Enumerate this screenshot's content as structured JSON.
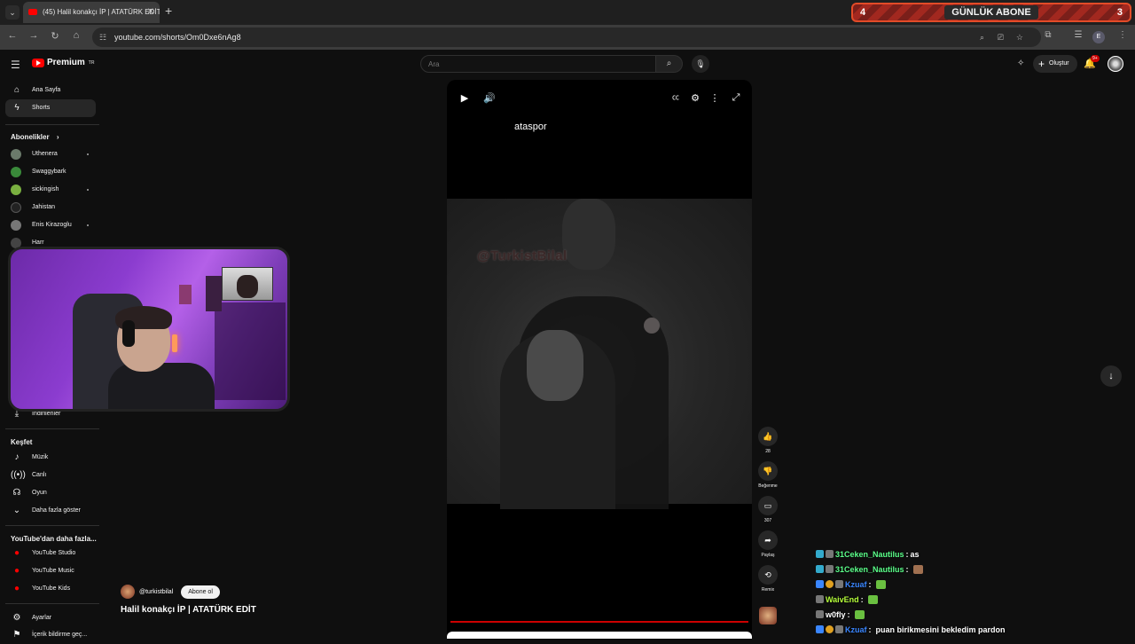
{
  "browser": {
    "tab_title": "(45) Halil konakçı İP | ATATÜRK EDİT",
    "url": "youtube.com/shorts/Om0Dxe6nAg8"
  },
  "overlay": {
    "left_num": "4",
    "label": "GÜNLÜK ABONE",
    "right_num": "3"
  },
  "header": {
    "logo": "Premium",
    "logo_region": "TR",
    "search_placeholder": "Ara",
    "create_label": "Oluştur",
    "notif_count": "9+"
  },
  "sidebar": {
    "home": "Ana Sayfa",
    "shorts": "Shorts",
    "subs_heading": "Abonelikler",
    "channels": [
      {
        "name": "Uthenera",
        "color": "#6b7a6b",
        "dot": true
      },
      {
        "name": "Swaggybark",
        "color": "#3a8a3a",
        "dot": false
      },
      {
        "name": "sickingish",
        "color": "#7ab040",
        "dot": true
      },
      {
        "name": "Jahistan",
        "color": "#222222",
        "dot": false
      },
      {
        "name": "Enis Kirazoglu",
        "color": "#777777",
        "dot": true
      }
    ],
    "partial_item": "Harr",
    "downloads": "İndirilenler",
    "explore_heading": "Keşfet",
    "explore": [
      "Müzik",
      "Canlı",
      "Oyun",
      "Daha fazla göster"
    ],
    "more_heading": "YouTube'dan daha fazla...",
    "more": [
      "YouTube Studio",
      "YouTube Music",
      "YouTube Kids"
    ],
    "settings": "Ayarlar",
    "report": "İçerik bildirme geç..."
  },
  "player": {
    "caption": "ataspor",
    "watermark": "@TurkistBilal",
    "channel": "@turkistbilal",
    "subscribe": "Abone ol",
    "title": "Halil konakçı İP | ATATÜRK EDİT",
    "progress": 1.0
  },
  "actions": {
    "likes": "28",
    "dislike": "Beğenme",
    "comments": "307",
    "share": "Paylaş",
    "remix": "Remix"
  },
  "chat": [
    {
      "user": "31Ceken_Nautilus",
      "color": "#5bff8a",
      "text": "as",
      "badges": [
        "#33aacc",
        "#777777"
      ],
      "emote": ""
    },
    {
      "user": "31Ceken_Nautilus",
      "color": "#5bff8a",
      "text": "",
      "badges": [
        "#33aacc",
        "#777777"
      ],
      "emote": "#a07050"
    },
    {
      "user": "Kzuaf",
      "color": "#3a86ff",
      "text": "",
      "badges": [
        "#3a86ff",
        "#e0a020",
        "#777777"
      ],
      "emote": "#6ac040"
    },
    {
      "user": "WaivEnd",
      "color": "#b6ff3a",
      "text": "",
      "badges": [
        "#777777"
      ],
      "emote": "#6ac040"
    },
    {
      "user": "w0fly",
      "color": "#ffffff",
      "text": "",
      "badges": [
        "#777777"
      ],
      "emote": "#6ac040"
    },
    {
      "user": "Kzuaf",
      "color": "#3a86ff",
      "text": "puan birikmesini bekledim pardon",
      "badges": [
        "#3a86ff",
        "#e0a020",
        "#777777"
      ],
      "emote": ""
    }
  ]
}
